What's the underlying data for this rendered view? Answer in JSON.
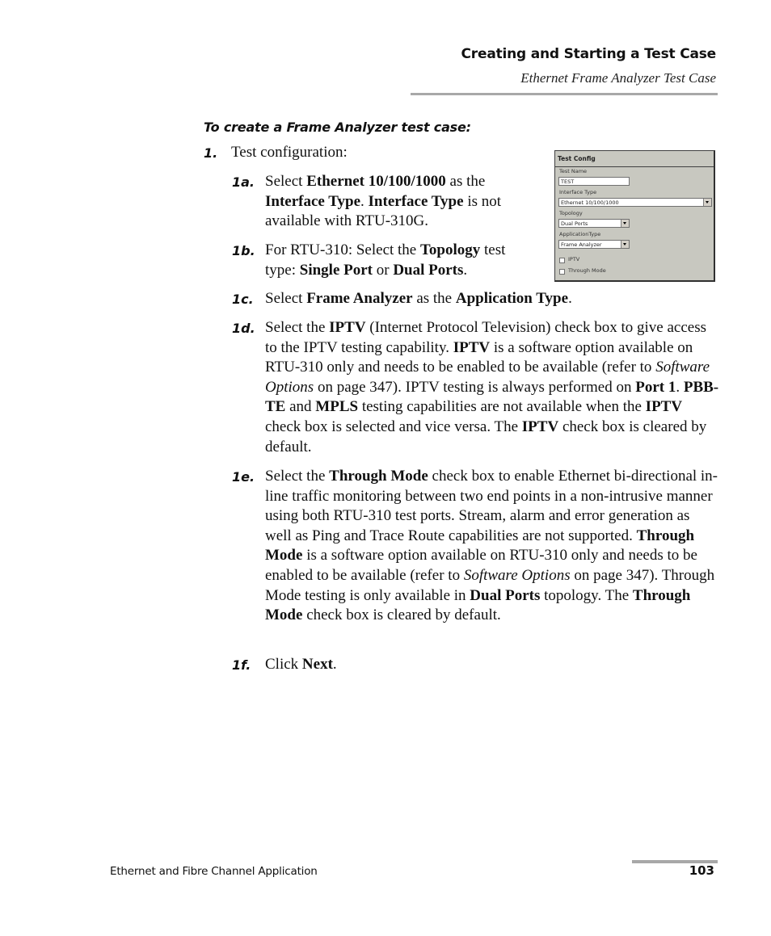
{
  "header": {
    "chapter_title": "Creating and Starting a Test Case",
    "section_title": "Ethernet Frame Analyzer Test Case"
  },
  "procedure": {
    "title": "To create a Frame Analyzer test case:",
    "step1": {
      "num": "1.",
      "text": "Test configuration:"
    },
    "step1a": {
      "num": "1a.",
      "parts": [
        "Select ",
        "Ethernet 10/100/1000",
        " as the ",
        "Interface Type",
        ". ",
        "Interface Type",
        " is not available with RTU-310G."
      ]
    },
    "step1b": {
      "num": "1b.",
      "parts": [
        "For RTU-310: Select the ",
        "Topology",
        " test type: ",
        "Single Port",
        " or ",
        "Dual Ports",
        "."
      ]
    },
    "step1c": {
      "num": "1c.",
      "parts": [
        "Select ",
        "Frame Analyzer",
        " as the ",
        "Application Type",
        "."
      ]
    },
    "step1d": {
      "num": "1d.",
      "parts": [
        "Select the ",
        "IPTV",
        " (Internet Protocol Television) check box to give access to the IPTV testing capability. ",
        "IPTV",
        " is a software option available on RTU-310 only and needs to be enabled to be available (refer to ",
        "Software Options",
        " on page 347). IPTV testing is always performed on ",
        "Port 1",
        ". ",
        "PBB-TE",
        " and ",
        "MPLS",
        " testing capabilities are not available when the ",
        "IPTV",
        " check box is selected and vice versa. The ",
        "IPTV",
        " check box is cleared by default."
      ]
    },
    "step1e": {
      "num": "1e.",
      "parts": [
        "Select the ",
        "Through Mode",
        " check box to enable Ethernet bi-directional in-line traffic monitoring between two end points in a non-intrusive manner using both RTU-310 test ports. Stream, alarm and error generation as well as Ping and Trace Route capabilities are not supported. ",
        "Through Mode",
        " is a software option available on RTU-310 only and needs to be enabled to be available (refer to ",
        "Software Options",
        " on page 347). Through Mode testing is only available in ",
        "Dual Ports",
        " topology. The ",
        "Through Mode",
        " check box is cleared by default."
      ]
    },
    "step1f": {
      "num": "1f.",
      "parts": [
        "Click ",
        "Next",
        "."
      ]
    }
  },
  "dialog": {
    "title": "Test Config",
    "test_name_label": "Test Name",
    "test_name_value": "TEST",
    "interface_type_label": "Interface Type",
    "interface_type_value": "Ethernet 10/100/1000",
    "topology_label": "Topology",
    "topology_value": "Dual Ports",
    "application_type_label": "ApplicationType",
    "application_type_value": "Frame Analyzer",
    "iptv_label": "IPTV",
    "iptv_checked": false,
    "through_mode_label": "Through Mode",
    "through_mode_checked": false
  },
  "footer": {
    "doc_title": "Ethernet and Fibre Channel Application",
    "page_number": "103"
  }
}
